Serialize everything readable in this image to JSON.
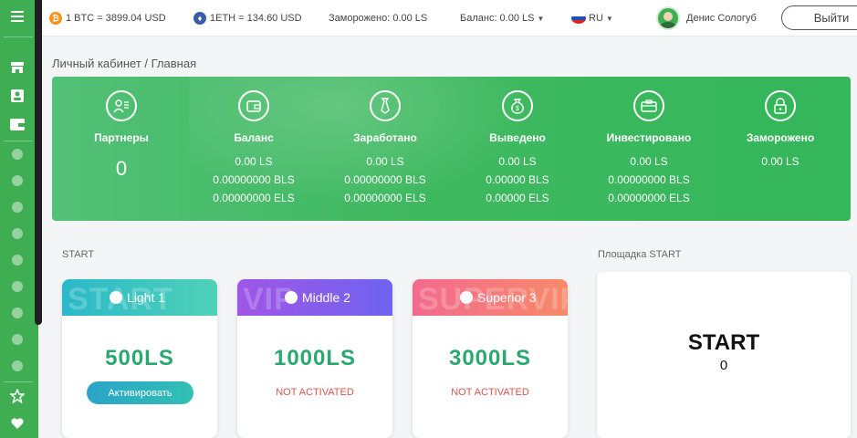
{
  "topbar": {
    "btc": "1 BTC = 3899.04 USD",
    "eth": "1ETH = 134.60 USD",
    "frozen": "Заморожено: 0.00 LS",
    "balance": "Баланс: 0.00 LS",
    "language": "RU",
    "user_name": "Денис Сологуб",
    "logout_label": "Выйти"
  },
  "breadcrumb": "Личный кабинет / Главная",
  "stats": {
    "partners": {
      "title": "Партнеры",
      "value": "0"
    },
    "balance": {
      "title": "Баланс",
      "ls": "0.00 LS",
      "bls": "0.00000000 BLS",
      "els": "0.00000000 ELS"
    },
    "earned": {
      "title": "Заработано",
      "ls": "0.00 LS",
      "bls": "0.00000000 BLS",
      "els": "0.00000000 ELS"
    },
    "withdrawn": {
      "title": "Выведено",
      "ls": "0.00 LS",
      "bls": "0.00000 BLS",
      "els": "0.00000 ELS"
    },
    "invested": {
      "title": "Инвестировано",
      "ls": "0.00 LS",
      "bls": "0.00000000 BLS",
      "els": "0.00000000 ELS"
    },
    "frozen": {
      "title": "Заморожено",
      "ls": "0.00 LS"
    }
  },
  "section_label": "START",
  "plans": [
    {
      "watermark": "START",
      "name": "Light 1",
      "price": "500LS",
      "action": "Активировать",
      "color_from": "#2bb9c9",
      "color_to": "#4fd1b8"
    },
    {
      "watermark": "VIP",
      "name": "Middle 2",
      "price": "1000LS",
      "status": "NOT ACTIVATED",
      "color_from": "#a056e6",
      "color_to": "#6f63f0"
    },
    {
      "watermark": "SUPERVIP",
      "name": "Superior 3",
      "price": "3000LS",
      "status": "NOT ACTIVATED",
      "color_from": "#f36a8e",
      "color_to": "#f78a6a"
    }
  ],
  "platform": {
    "label": "Площадка START",
    "title": "START",
    "value": "0"
  },
  "colors": {
    "sidebar": "#3fae52",
    "banner": "#3fb960",
    "price": "#2ba872",
    "status_red": "#d9534f"
  },
  "icons": {
    "sidebar": [
      "menu-icon",
      "shop-icon",
      "profile-icon",
      "wallet-icon",
      "star-icon",
      "handshake-icon"
    ]
  }
}
